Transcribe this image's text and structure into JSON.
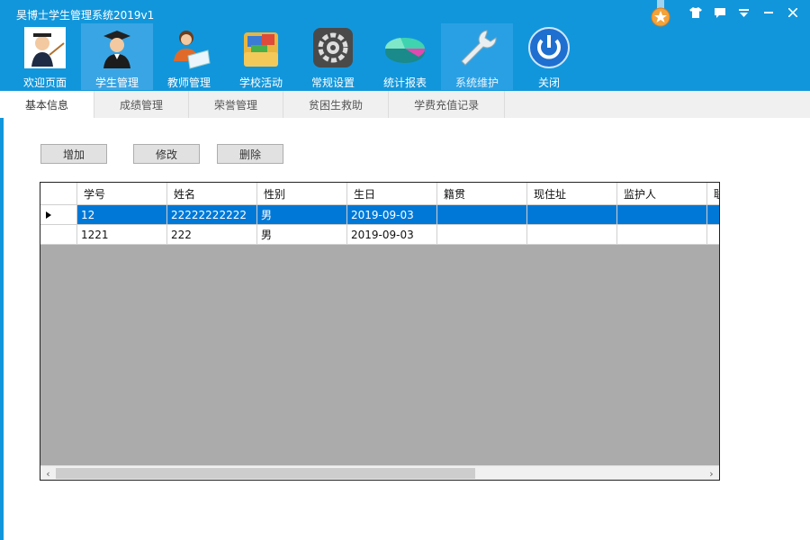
{
  "window": {
    "title": "昊博士学生管理系统2019v1",
    "controls": [
      "shirt-icon",
      "message-icon",
      "dropdown-icon",
      "minimize-icon",
      "close-icon"
    ]
  },
  "toolbar": [
    {
      "label": "欢迎页面",
      "icon": "teacher-pointer-icon"
    },
    {
      "label": "学生管理",
      "icon": "graduate-icon"
    },
    {
      "label": "教师管理",
      "icon": "teacher-writing-icon"
    },
    {
      "label": "学校活动",
      "icon": "folder-icon"
    },
    {
      "label": "常规设置",
      "icon": "gear-icon"
    },
    {
      "label": "统计报表",
      "icon": "chart-icon"
    },
    {
      "label": "系统维护",
      "icon": "wrench-icon"
    },
    {
      "label": "关闭",
      "icon": "power-icon"
    }
  ],
  "tabs": [
    "基本信息",
    "成绩管理",
    "荣誉管理",
    "贫困生救助",
    "学费充值记录"
  ],
  "actions": {
    "add": "增加",
    "edit": "修改",
    "delete": "删除"
  },
  "table": {
    "columns": [
      "学号",
      "姓名",
      "性别",
      "生日",
      "籍贯",
      "现住址",
      "监护人",
      "联"
    ],
    "rows": [
      {
        "selected": true,
        "cells": [
          "12",
          "22222222222",
          "男",
          "2019-09-03",
          "",
          "",
          "",
          ""
        ]
      },
      {
        "selected": false,
        "cells": [
          "1221",
          "222",
          "男",
          "2019-09-03",
          "",
          "",
          "",
          ""
        ]
      }
    ]
  },
  "colors": {
    "titlebar": "#1296db",
    "selection": "#0078d7",
    "grid_empty": "#ababab"
  }
}
